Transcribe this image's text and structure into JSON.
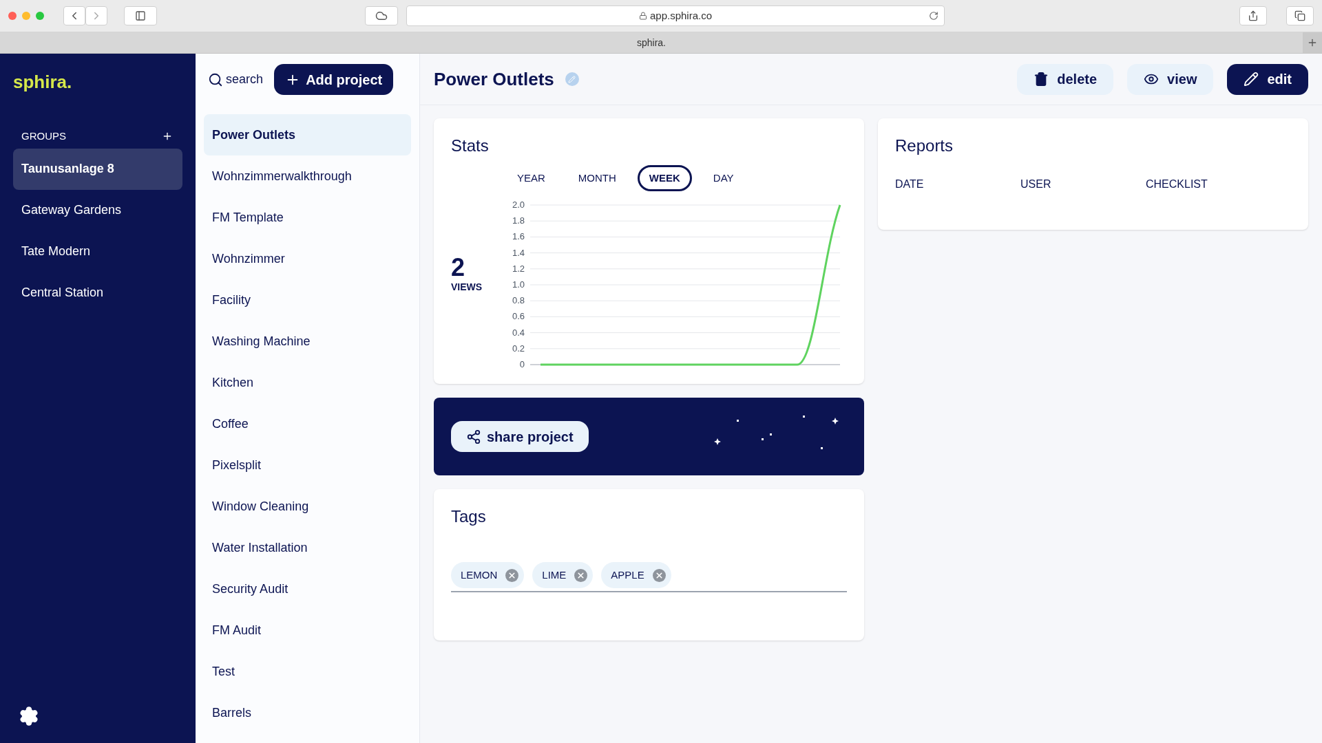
{
  "browser": {
    "url": "app.sphira.co",
    "tab_title": "sphira."
  },
  "sidebar": {
    "logo": "sphira.",
    "groups_label": "GROUPS",
    "groups": [
      {
        "label": "Taunusanlage 8",
        "selected": true
      },
      {
        "label": "Gateway Gardens",
        "selected": false
      },
      {
        "label": "Tate Modern",
        "selected": false
      },
      {
        "label": "Central Station",
        "selected": false
      }
    ]
  },
  "projects": {
    "search_label": "search",
    "add_button": "Add project",
    "items": [
      {
        "label": "Power Outlets",
        "selected": true
      },
      {
        "label": "Wohnzimmerwalkthrough",
        "selected": false
      },
      {
        "label": "FM Template",
        "selected": false
      },
      {
        "label": "Wohnzimmer",
        "selected": false
      },
      {
        "label": "Facility",
        "selected": false
      },
      {
        "label": "Washing Machine",
        "selected": false
      },
      {
        "label": "Kitchen",
        "selected": false
      },
      {
        "label": "Coffee",
        "selected": false
      },
      {
        "label": "Pixelsplit",
        "selected": false
      },
      {
        "label": "Window Cleaning",
        "selected": false
      },
      {
        "label": "Water Installation",
        "selected": false
      },
      {
        "label": "Security Audit",
        "selected": false
      },
      {
        "label": "FM Audit",
        "selected": false
      },
      {
        "label": "Test",
        "selected": false
      },
      {
        "label": "Barrels",
        "selected": false
      }
    ]
  },
  "header": {
    "title": "Power Outlets",
    "buttons": [
      {
        "kind": "delete",
        "label": "delete"
      },
      {
        "kind": "view",
        "label": "view"
      },
      {
        "kind": "edit",
        "label": "edit"
      }
    ]
  },
  "stats": {
    "title": "Stats",
    "periods": [
      {
        "label": "YEAR",
        "selected": false
      },
      {
        "label": "MONTH",
        "selected": false
      },
      {
        "label": "WEEK",
        "selected": true
      },
      {
        "label": "DAY",
        "selected": false
      }
    ],
    "total": "2",
    "total_label": "VIEWS",
    "chart_data": {
      "type": "line",
      "grid": true,
      "ylim": [
        0,
        2
      ],
      "yticks": [
        {
          "value": 0,
          "label": "0"
        },
        {
          "value": 0.2,
          "label": "0.2"
        },
        {
          "value": 0.4,
          "label": "0.4"
        },
        {
          "value": 0.6,
          "label": "0.6"
        },
        {
          "value": 0.8,
          "label": "0.8"
        },
        {
          "value": 1,
          "label": "1.0"
        },
        {
          "value": 1.2,
          "label": "1.2"
        },
        {
          "value": 1.4,
          "label": "1.4"
        },
        {
          "value": 1.6,
          "label": "1.6"
        },
        {
          "value": 1.8,
          "label": "1.8"
        },
        {
          "value": 2,
          "label": "2.0"
        }
      ],
      "series": [
        {
          "color": "#5fd35f",
          "values": [
            0,
            0,
            0,
            0,
            0,
            0,
            0,
            2
          ]
        }
      ]
    }
  },
  "share": {
    "button": "share project"
  },
  "tags": {
    "title": "Tags",
    "items": [
      {
        "label": "LEMON"
      },
      {
        "label": "LIME"
      },
      {
        "label": "APPLE"
      }
    ]
  },
  "reports": {
    "title": "Reports",
    "columns": [
      "DATE",
      "USER",
      "CHECKLIST"
    ]
  }
}
